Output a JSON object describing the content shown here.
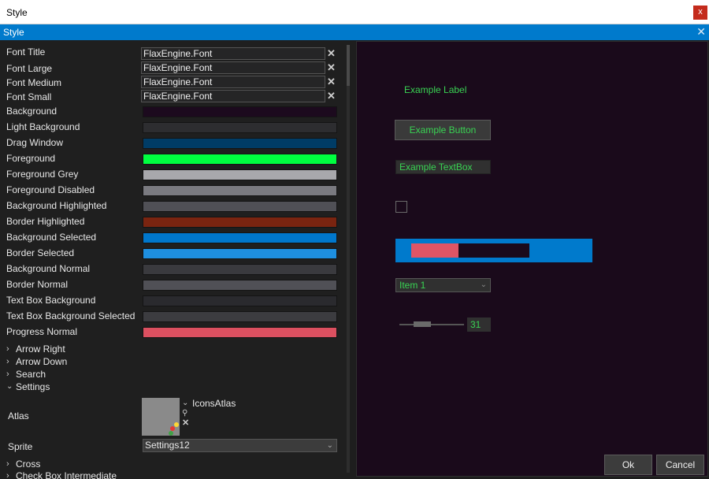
{
  "window": {
    "title": "Style",
    "close_label": "x"
  },
  "header": {
    "title": "Style",
    "close_label": "✕"
  },
  "fonts": [
    {
      "label": "Font Title",
      "value": "FlaxEngine.Font"
    },
    {
      "label": "Font Large",
      "value": "FlaxEngine.Font"
    },
    {
      "label": "Font Medium",
      "value": "FlaxEngine.Font"
    },
    {
      "label": "Font Small",
      "value": "FlaxEngine.Font"
    }
  ],
  "colors": [
    {
      "label": "Background",
      "color": "#1c0a1e"
    },
    {
      "label": "Light Background",
      "color": "#2d2d30"
    },
    {
      "label": "Drag Window",
      "color": "#003c66"
    },
    {
      "label": "Foreground",
      "color": "#00ff40"
    },
    {
      "label": "Foreground Grey",
      "color": "#a8a8ac"
    },
    {
      "label": "Foreground Disabled",
      "color": "#7a7a80"
    },
    {
      "label": "Background Highlighted",
      "color": "#505056"
    },
    {
      "label": "Border Highlighted",
      "color": "#7a2410"
    },
    {
      "label": "Background Selected",
      "color": "#0077cc"
    },
    {
      "label": "Border Selected",
      "color": "#1e8fe0"
    },
    {
      "label": "Background Normal",
      "color": "#3a3a3e"
    },
    {
      "label": "Border Normal",
      "color": "#505056"
    },
    {
      "label": "Text Box Background",
      "color": "#2a2a2e"
    },
    {
      "label": "Text Box Background Selected",
      "color": "#3c3c40"
    },
    {
      "label": "Progress Normal",
      "color": "#dc5060"
    }
  ],
  "collapsed": [
    "Arrow Right",
    "Arrow Down",
    "Search"
  ],
  "settings": {
    "label": "Settings",
    "atlas_label": "Atlas",
    "atlas_name": "IconsAtlas",
    "sprite_label": "Sprite",
    "sprite_value": "Settings12"
  },
  "after": [
    "Cross",
    "Check Box Intermediate"
  ],
  "preview": {
    "label": "Example Label",
    "button": "Example Button",
    "textbox": "Example TextBox",
    "progress": 0.4,
    "dropdown": "Item 1",
    "slider_value": "31"
  },
  "buttons": {
    "ok": "Ok",
    "cancel": "Cancel"
  }
}
